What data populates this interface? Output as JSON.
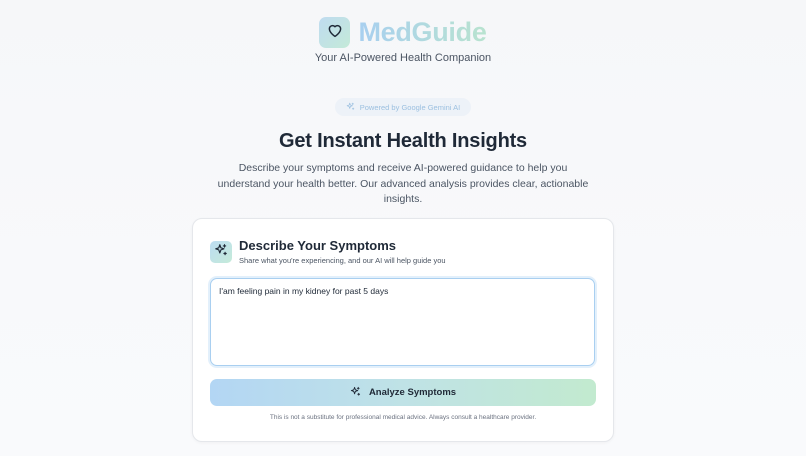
{
  "brand": {
    "name": "MedGuide",
    "tagline": "Your AI-Powered Health Companion"
  },
  "badge": {
    "label": "Powered by Google Gemini AI"
  },
  "hero": {
    "title": "Get Instant Health Insights",
    "description": "Describe your symptoms and receive AI-powered guidance to help you understand your health better. Our advanced analysis provides clear, actionable insights."
  },
  "symptom_card": {
    "title": "Describe Your Symptoms",
    "subtitle": "Share what you're experiencing, and our AI will help guide you",
    "input_value": "I'am feeling pain in my kidney for past 5 days",
    "button_label": "Analyze Symptoms",
    "disclaimer": "This is not a substitute for professional medical advice. Always consult a healthcare provider."
  },
  "icons": {
    "logo": "heart-icon",
    "badge": "sparkles-icon",
    "card": "sparkles-icon",
    "button": "sparkles-icon"
  },
  "colors": {
    "brand_blue": "#a8cff0",
    "brand_green": "#b8e3cf",
    "text_dark": "#1f2937",
    "text_muted": "#4b5563"
  }
}
